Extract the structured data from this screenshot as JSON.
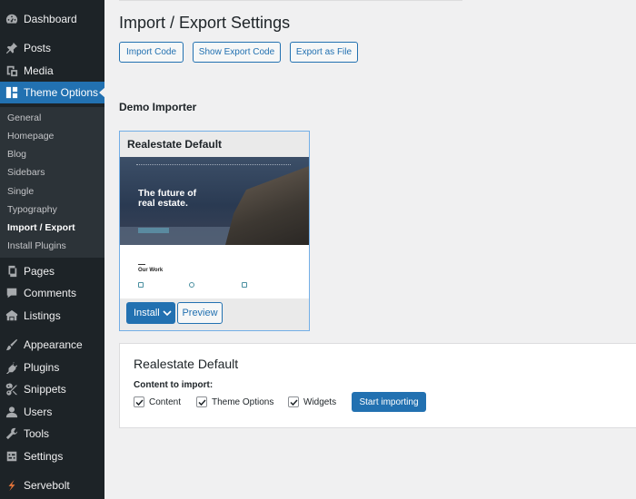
{
  "sidebar": {
    "items": [
      {
        "label": "Dashboard",
        "icon": "dashboard-icon"
      },
      {
        "label": "Posts",
        "icon": "pin-icon"
      },
      {
        "label": "Media",
        "icon": "media-icon"
      },
      {
        "label": "Theme Options",
        "icon": "grid-icon",
        "active": true
      },
      {
        "label": "Pages",
        "icon": "pages-icon"
      },
      {
        "label": "Comments",
        "icon": "comment-icon"
      },
      {
        "label": "Listings",
        "icon": "listings-icon"
      },
      {
        "label": "Appearance",
        "icon": "brush-icon"
      },
      {
        "label": "Plugins",
        "icon": "plugin-icon"
      },
      {
        "label": "Snippets",
        "icon": "scissors-icon"
      },
      {
        "label": "Users",
        "icon": "user-icon"
      },
      {
        "label": "Tools",
        "icon": "wrench-icon"
      },
      {
        "label": "Settings",
        "icon": "settings-icon"
      },
      {
        "label": "Servebolt",
        "icon": "servebolt-icon"
      }
    ],
    "submenu": [
      "General",
      "Homepage",
      "Blog",
      "Sidebars",
      "Single",
      "Typography",
      "Import / Export",
      "Install Plugins"
    ],
    "submenu_current": "Import / Export"
  },
  "main": {
    "title": "Import / Export Settings",
    "buttons": {
      "import": "Import Code",
      "show_export": "Show Export Code",
      "export_file": "Export as File"
    },
    "demo_heading": "Demo Importer"
  },
  "card": {
    "title": "Realestate Default",
    "thumb": {
      "hero_line1": "The future of",
      "hero_line2": "real estate.",
      "section": "Our Work"
    },
    "install": "Install",
    "preview": "Preview"
  },
  "panel": {
    "title": "Realestate Default",
    "content_label": "Content to import:",
    "checks": [
      {
        "label": "Content",
        "checked": true
      },
      {
        "label": "Theme Options",
        "checked": true
      },
      {
        "label": "Widgets",
        "checked": true
      }
    ],
    "start": "Start importing"
  },
  "colors": {
    "sidebar": "#1d2327",
    "submenu": "#2c3338",
    "accent": "#2271b1",
    "background": "#f0f0f1"
  }
}
